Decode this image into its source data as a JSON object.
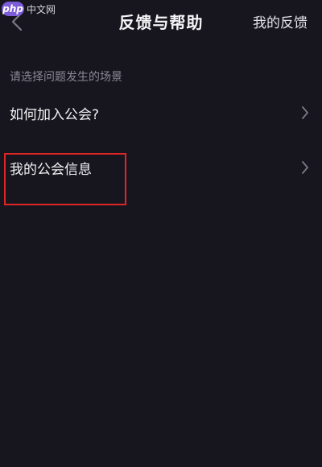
{
  "watermark": {
    "badge": "php",
    "text": "中文网"
  },
  "header": {
    "title": "反馈与帮助",
    "right_action": "我的反馈"
  },
  "section": {
    "label": "请选择问题发生的场景"
  },
  "list": {
    "items": [
      {
        "label": "如何加入公会?"
      },
      {
        "label": "我的公会信息"
      }
    ]
  },
  "icons": {
    "back": "chevron-left-icon",
    "row_arrow": "chevron-right-icon"
  },
  "colors": {
    "background": "#17161f",
    "text": "#f2f2f5",
    "muted_text": "#8a8994",
    "icon": "#7b7a85",
    "highlight": "#e02525"
  }
}
